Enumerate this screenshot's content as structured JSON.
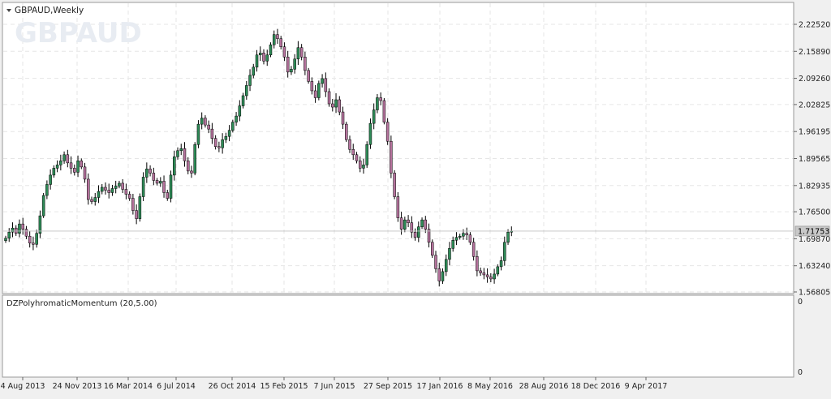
{
  "symbol_title": "GBPAUD,Weekly",
  "watermark": "GBPAUD",
  "indicator": {
    "label": "DZPolyhromaticMomentum (20,5.00)",
    "ticks": [
      "0",
      "0"
    ]
  },
  "current_price": "1.71753",
  "colors": {
    "background": "#ffffff",
    "outer": "#f0f0f0",
    "grid": "#e6e6e6",
    "bull": "#2e8b57",
    "bear": "#b5739d",
    "wick": "#000000",
    "price_tag_bg": "#c8c8c8"
  },
  "chart_data": {
    "type": "candlestick",
    "timeframe": "Weekly",
    "y_ticks": [
      "2.22520",
      "2.15890",
      "2.09260",
      "2.02825",
      "1.96195",
      "1.89565",
      "1.82935",
      "1.76500",
      "1.69870",
      "1.63240",
      "1.56805"
    ],
    "ylim": [
      1.565,
      2.245
    ],
    "x_ticks": [
      "4 Aug 2013",
      "24 Nov 2013",
      "16 Mar 2014",
      "6 Jul 2014",
      "26 Oct 2014",
      "15 Feb 2015",
      "7 Jun 2015",
      "27 Sep 2015",
      "17 Jan 2016",
      "8 May 2016",
      "28 Aug 2016",
      "18 Dec 2016",
      "9 Apr 2017"
    ],
    "close_series": [
      1.7,
      1.715,
      1.725,
      1.712,
      1.735,
      1.722,
      1.705,
      1.688,
      1.685,
      1.712,
      1.755,
      1.805,
      1.832,
      1.855,
      1.872,
      1.88,
      1.89,
      1.905,
      1.885,
      1.872,
      1.862,
      1.89,
      1.875,
      1.845,
      1.795,
      1.79,
      1.8,
      1.815,
      1.825,
      1.818,
      1.812,
      1.822,
      1.828,
      1.835,
      1.82,
      1.808,
      1.798,
      1.768,
      1.748,
      1.802,
      1.85,
      1.87,
      1.86,
      1.842,
      1.835,
      1.84,
      1.812,
      1.798,
      1.855,
      1.9,
      1.915,
      1.92,
      1.89,
      1.865,
      1.86,
      1.93,
      1.98,
      1.995,
      1.978,
      1.968,
      1.945,
      1.925,
      1.922,
      1.942,
      1.95,
      1.965,
      1.985,
      2.0,
      2.025,
      2.05,
      2.075,
      2.1,
      2.12,
      2.15,
      2.155,
      2.135,
      2.15,
      2.175,
      2.2,
      2.19,
      2.17,
      2.145,
      2.108,
      2.115,
      2.14,
      2.168,
      2.145,
      2.112,
      2.085,
      2.062,
      2.045,
      2.08,
      2.092,
      2.06,
      2.03,
      2.022,
      2.04,
      2.01,
      1.98,
      1.942,
      1.918,
      1.905,
      1.89,
      1.872,
      1.88,
      1.93,
      1.982,
      2.015,
      2.045,
      2.038,
      1.985,
      1.938,
      1.86,
      1.802,
      1.75,
      1.722,
      1.745,
      1.738,
      1.715,
      1.702,
      1.728,
      1.745,
      1.722,
      1.69,
      1.658,
      1.625,
      1.595,
      1.618,
      1.648,
      1.675,
      1.695,
      1.702,
      1.705,
      1.712,
      1.708,
      1.69,
      1.655,
      1.62,
      1.615,
      1.61,
      1.605,
      1.6,
      1.612,
      1.63,
      1.645,
      1.69,
      1.715,
      1.718
    ]
  }
}
